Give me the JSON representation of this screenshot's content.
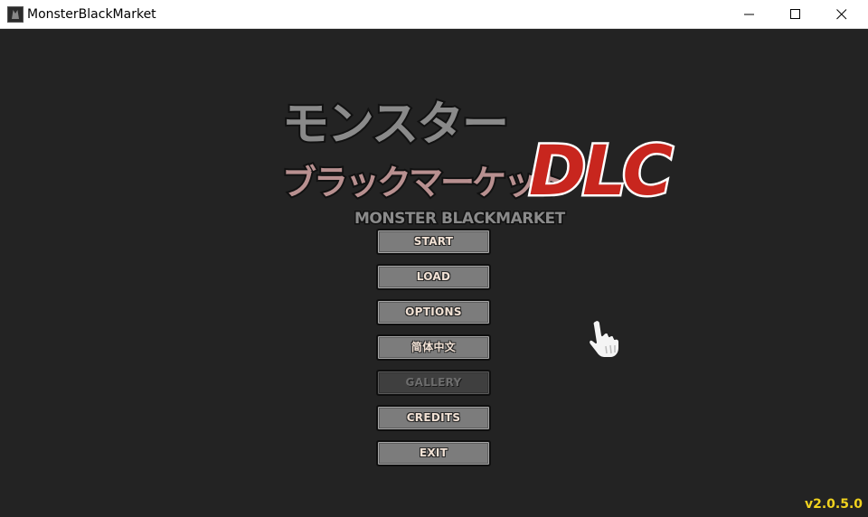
{
  "window": {
    "title": "MonsterBlackMarket",
    "icon": "app-icon",
    "controls": [
      "minimize-icon",
      "maximize-icon",
      "close-icon"
    ]
  },
  "logo": {
    "line1": "モンスター",
    "line2": "ブラックマーケット",
    "dlc": "DLC",
    "english": "MONSTER BLACKMARKET"
  },
  "menu": [
    {
      "label": "START",
      "enabled": true
    },
    {
      "label": "LOAD",
      "enabled": true
    },
    {
      "label": "OPTIONS",
      "enabled": true
    },
    {
      "label": "简体中文",
      "enabled": true
    },
    {
      "label": "GALLERY",
      "enabled": false
    },
    {
      "label": "CREDITS",
      "enabled": true
    },
    {
      "label": "EXIT",
      "enabled": true
    }
  ],
  "version": "v2.0.5.0",
  "colors": {
    "background": "#232323",
    "button": "#7c7c7c",
    "button_disabled": "#3f3f3f",
    "button_text": "#f2e2d5",
    "version": "#f0d21e",
    "dlc_red": "#c8261e"
  }
}
